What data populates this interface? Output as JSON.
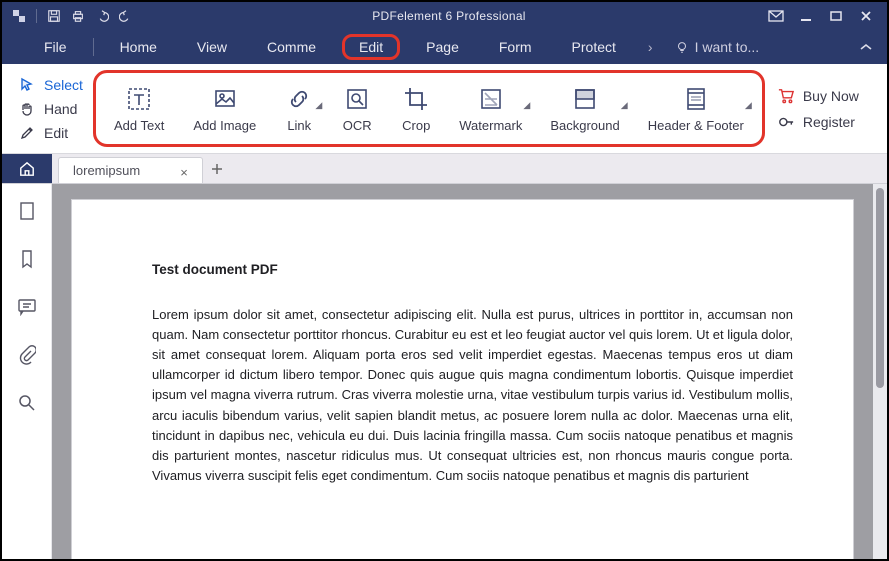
{
  "titlebar": {
    "title": "PDFelement 6 Professional"
  },
  "menu": {
    "items": [
      "File",
      "Home",
      "View",
      "Comme",
      "Edit",
      "Page",
      "Form",
      "Protect"
    ],
    "active_index": 4,
    "i_want_to": "I want to..."
  },
  "ribbon": {
    "left": {
      "select": "Select",
      "hand": "Hand",
      "edit": "Edit"
    },
    "buttons": {
      "add_text": "Add Text",
      "add_image": "Add Image",
      "link": "Link",
      "ocr": "OCR",
      "crop": "Crop",
      "watermark": "Watermark",
      "background": "Background",
      "header_footer": "Header & Footer"
    },
    "right": {
      "buy_now": "Buy Now",
      "register": "Register"
    }
  },
  "tabs": {
    "doc_name": "loremipsum"
  },
  "document": {
    "title": "Test document PDF",
    "body": "Lorem ipsum dolor sit amet, consectetur adipiscing elit. Nulla est purus, ultrices in porttitor in, accumsan non quam. Nam consectetur porttitor rhoncus. Curabitur eu est et leo feugiat auctor vel quis lorem. Ut et ligula dolor, sit amet consequat lorem. Aliquam porta eros sed velit imperdiet egestas. Maecenas tempus eros ut diam ullamcorper id dictum libero tempor. Donec quis augue quis magna condimentum lobortis. Quisque imperdiet ipsum vel magna viverra rutrum. Cras viverra molestie urna, vitae vestibulum turpis varius id. Vestibulum mollis, arcu iaculis bibendum varius, velit sapien blandit metus, ac posuere lorem nulla ac dolor. Maecenas urna elit, tincidunt in dapibus nec, vehicula eu dui. Duis lacinia fringilla massa. Cum sociis natoque penatibus et magnis dis parturient montes, nascetur ridiculus mus. Ut consequat ultricies est, non rhoncus mauris congue porta. Vivamus viverra suscipit felis eget condimentum. Cum sociis natoque penatibus et magnis dis parturient"
  }
}
